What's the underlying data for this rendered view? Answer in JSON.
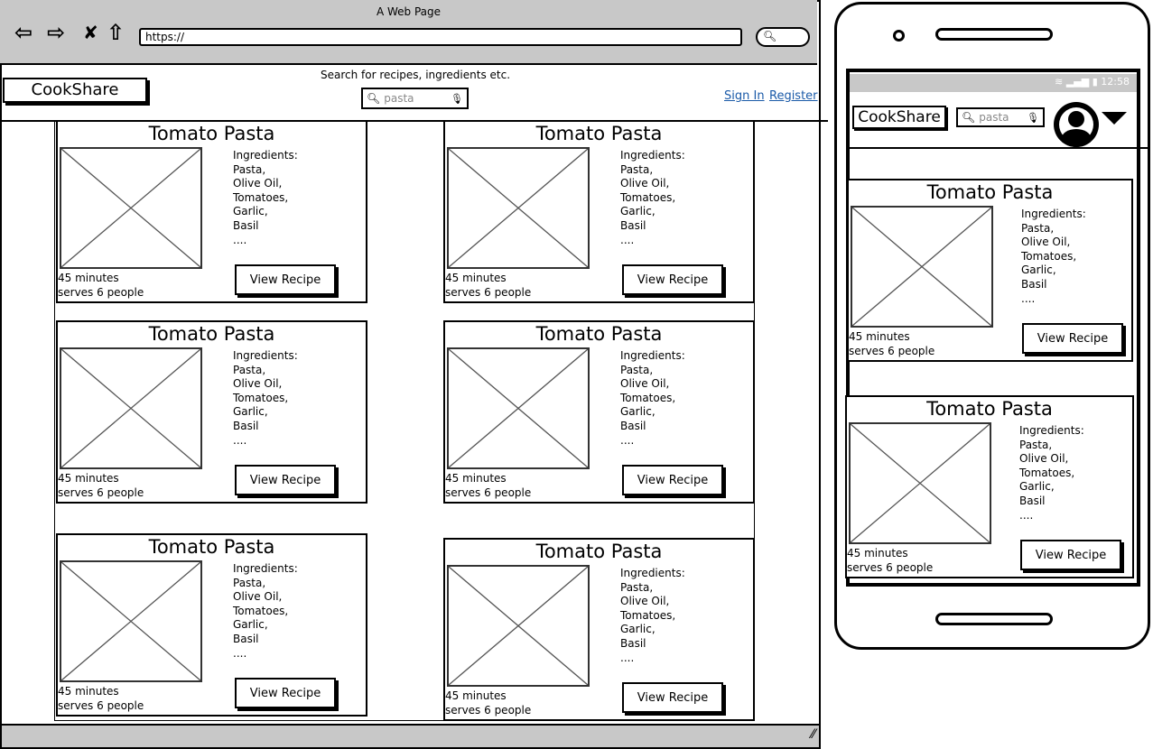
{
  "browser": {
    "title": "A Web Page",
    "url": "https://",
    "icons": [
      "back-arrow-icon",
      "forward-arrow-icon",
      "close-x-icon",
      "home-icon",
      "search-icon"
    ]
  },
  "header": {
    "logo": "CookShare",
    "search_label": "Search for recipes, ingredients etc.",
    "search_value": "pasta",
    "sign_in": "Sign In",
    "register": "Register"
  },
  "recipe": {
    "title": "Tomato Pasta",
    "ingredients_label": "Ingredients:",
    "ingredients": [
      "Pasta,",
      "Olive Oil,",
      "Tomatoes,",
      "Garlic,",
      "Basil",
      "...."
    ],
    "time": "45 minutes",
    "serves": "serves 6 people",
    "button": "View Recipe"
  },
  "mobile": {
    "time": "12:58",
    "logo": "CookShare",
    "search_value": "pasta",
    "icons": [
      "wifi-icon",
      "signal-icon",
      "battery-icon",
      "avatar-icon",
      "dropdown-triangle-icon"
    ]
  },
  "desktop_cards": 6,
  "mobile_cards": 2
}
